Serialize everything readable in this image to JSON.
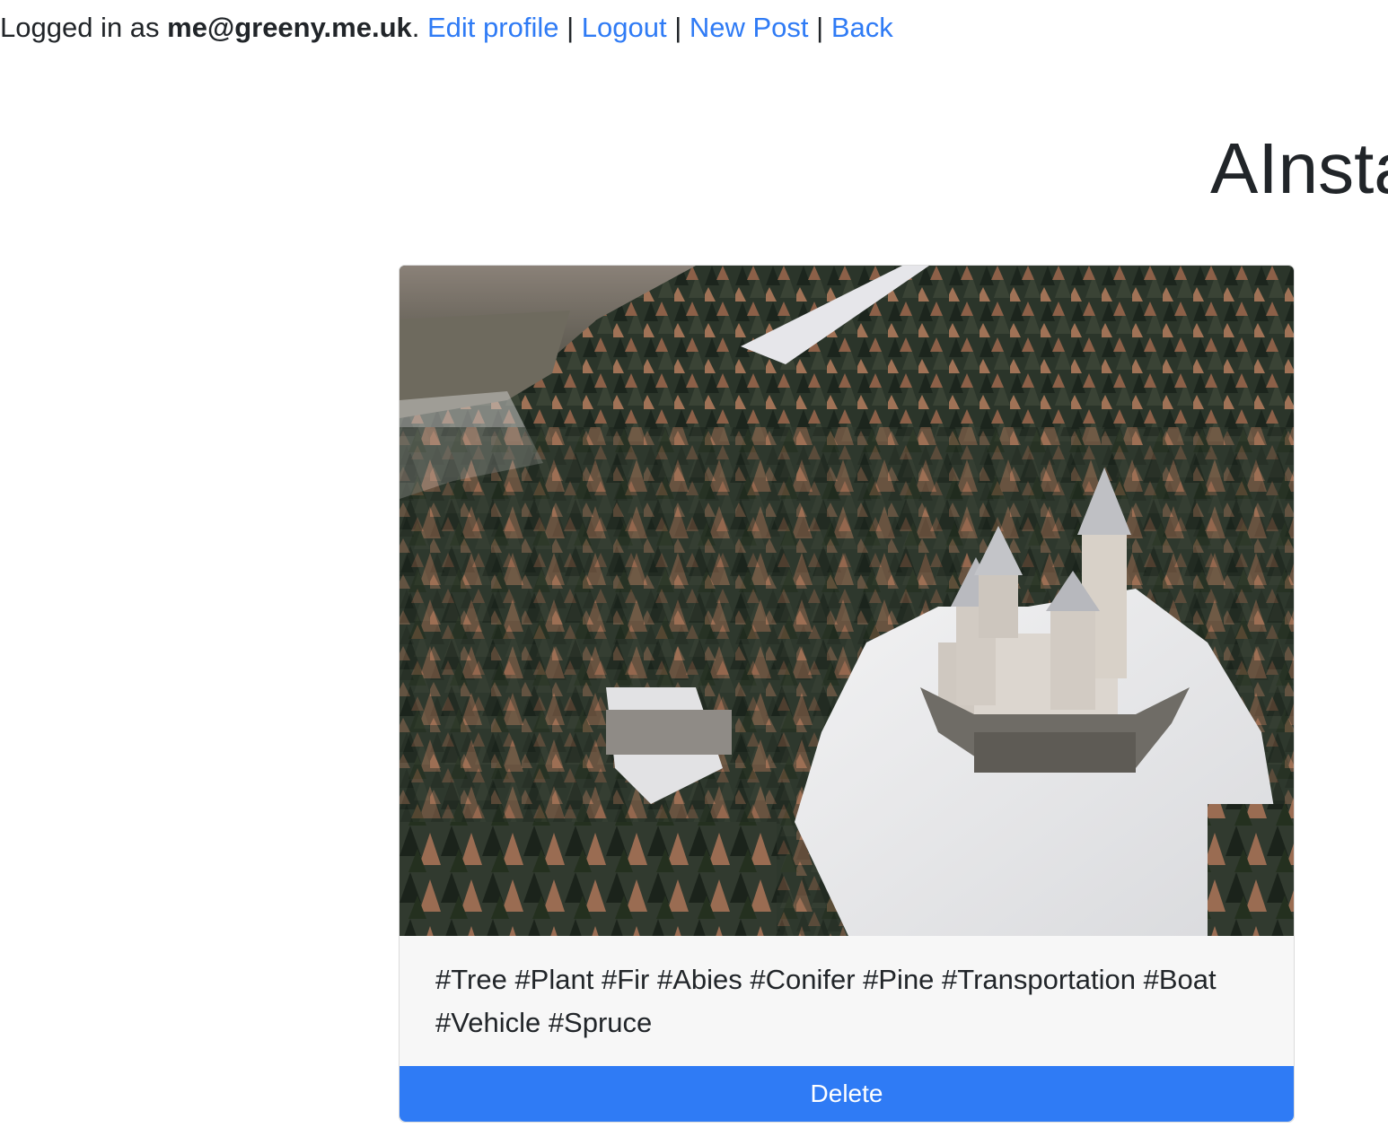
{
  "header": {
    "logged_in_prefix": "Logged in as ",
    "user_email": "me@greeny.me.uk",
    "after_email": ". ",
    "links": {
      "edit_profile": "Edit profile",
      "logout": "Logout",
      "new_post": "New Post",
      "back": "Back"
    },
    "separator": " | "
  },
  "page": {
    "title": "AInsta"
  },
  "post": {
    "image_icon": "photo-castle-forest",
    "tags": "#Tree #Plant #Fir #Abies #Conifer #Pine #Transportation #Boat #Vehicle #Spruce",
    "delete_label": "Delete"
  },
  "colors": {
    "link": "#2f7bf5",
    "button": "#2f7bf5",
    "card_footer": "#f7f7f7"
  }
}
